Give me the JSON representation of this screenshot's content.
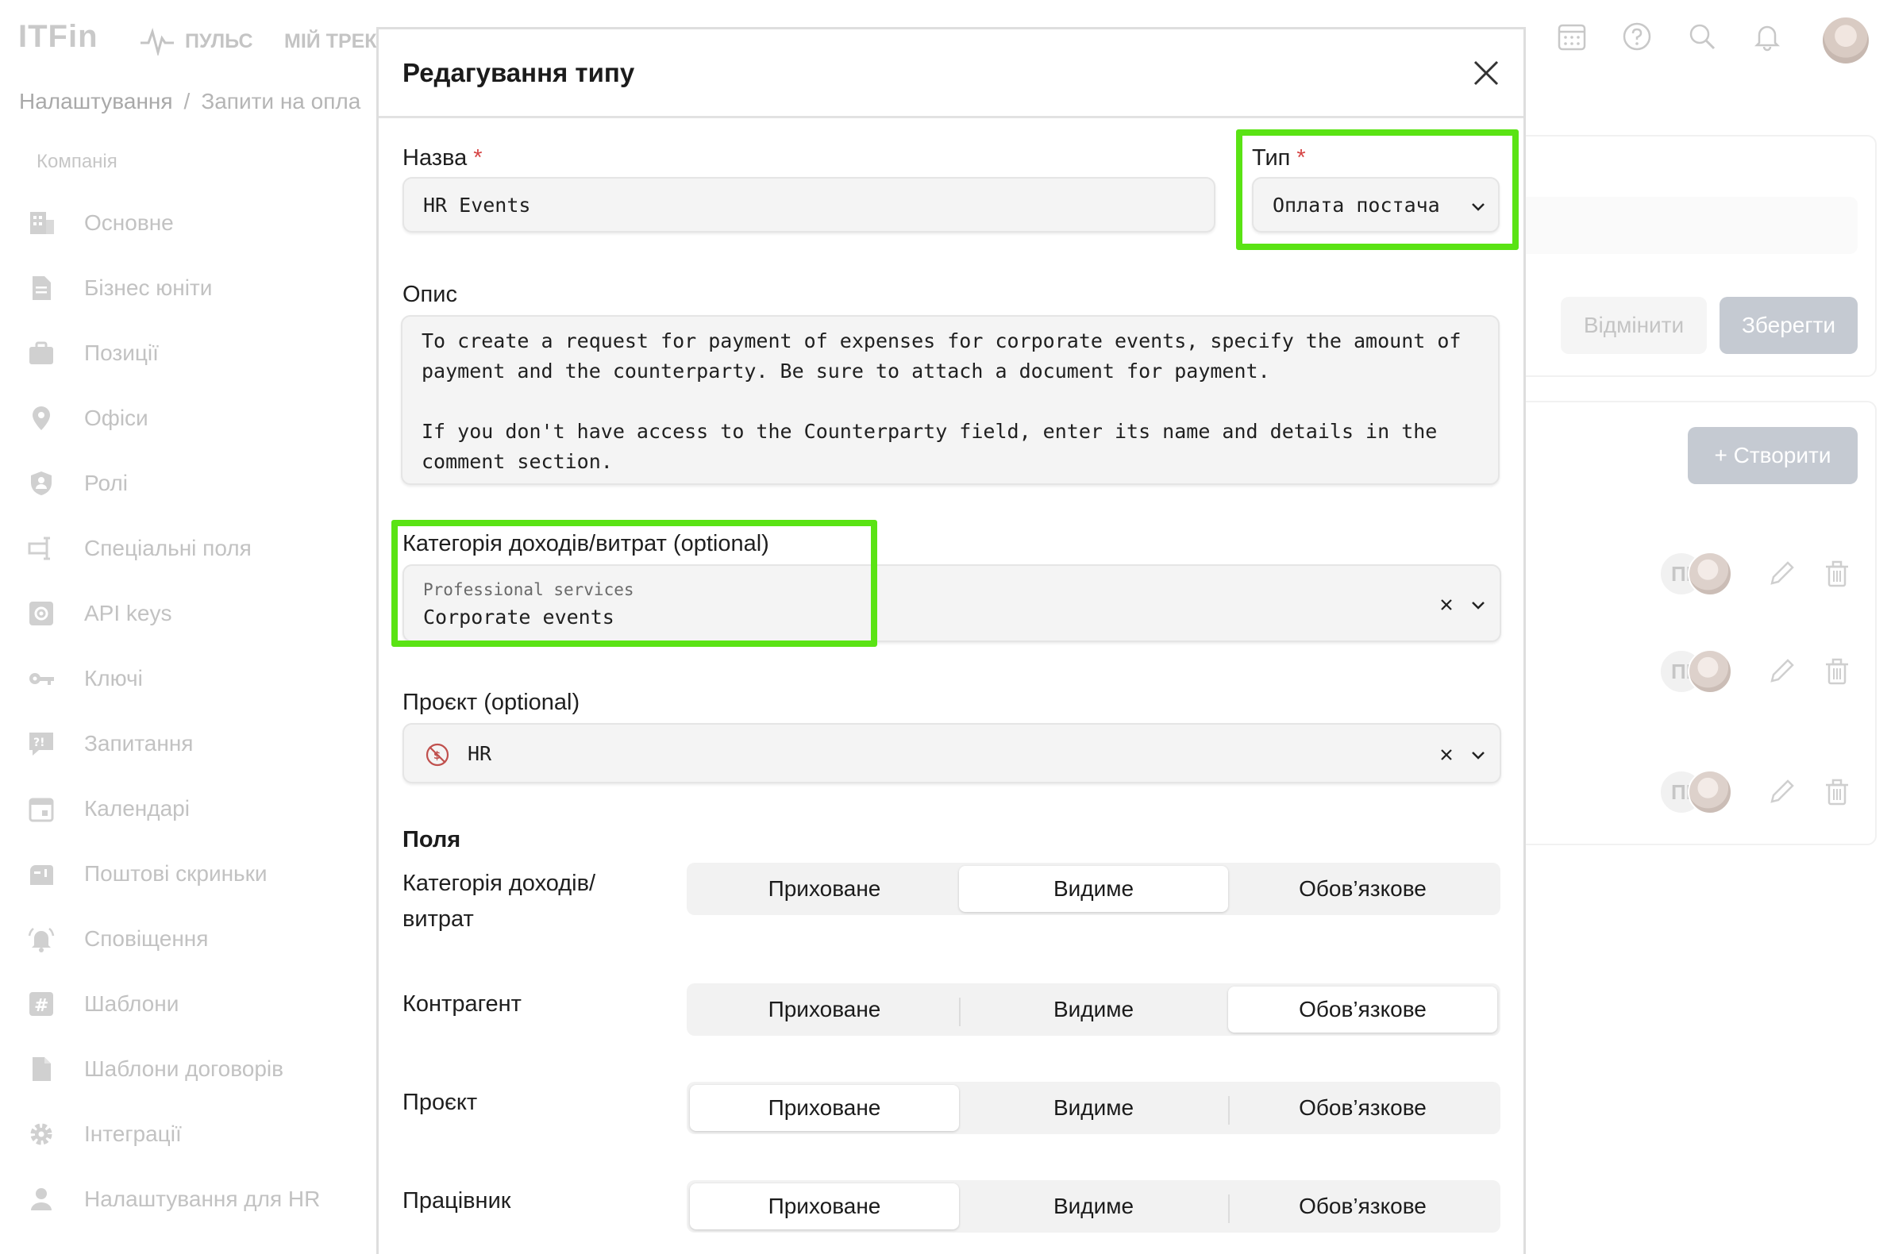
{
  "app": {
    "logo": "ITFin",
    "nav": {
      "pulse": "ПУЛЬС",
      "tracker": "МІЙ ТРЕКЕ"
    },
    "breadcrumb": {
      "first": "Налаштування",
      "separator": "/",
      "second": "Запити на опла"
    },
    "sidebar": {
      "section": "Компанія",
      "items": [
        {
          "label": "Основне",
          "icon": "building-icon"
        },
        {
          "label": "Бізнес юніти",
          "icon": "document-icon"
        },
        {
          "label": "Позиції",
          "icon": "briefcase-icon"
        },
        {
          "label": "Офіси",
          "icon": "map-pin-icon"
        },
        {
          "label": "Ролі",
          "icon": "shield-user-icon"
        },
        {
          "label": "Спеціальні поля",
          "icon": "custom-field-icon"
        },
        {
          "label": "API keys",
          "icon": "api-gear-icon"
        },
        {
          "label": "Ключі",
          "icon": "key-icon"
        },
        {
          "label": "Запитання",
          "icon": "question-chat-icon"
        },
        {
          "label": "Календарі",
          "icon": "calendar-icon"
        },
        {
          "label": "Поштові скриньки",
          "icon": "mailbox-icon"
        },
        {
          "label": "Сповіщення",
          "icon": "bell-icon"
        },
        {
          "label": "Шаблони",
          "icon": "hash-icon"
        },
        {
          "label": "Шаблони договорів",
          "icon": "file-icon"
        },
        {
          "label": "Інтеграції",
          "icon": "gear-icon"
        },
        {
          "label": "Налаштування для HR",
          "icon": "person-icon"
        }
      ]
    },
    "right": {
      "cancel": "Відмінити",
      "save": "Зберегти",
      "create": "+ Створити",
      "row_initials": "ПІ"
    }
  },
  "modal": {
    "title": "Редагування типу",
    "name": {
      "label": "Назва",
      "required": "*",
      "value": "HR Events"
    },
    "type": {
      "label": "Тип",
      "required": "*",
      "value": "Оплата постача"
    },
    "description": {
      "label": "Опис",
      "value": "To create a request for payment of expenses for corporate events, specify the amount of\npayment and the counterparty. Be sure to attach a document for payment.\n\nIf you don't have access to the Counterparty field, enter its name and details in the\ncomment section."
    },
    "category": {
      "label": "Категорія доходів/витрат (optional)",
      "parent": "Professional services",
      "value": "Corporate events",
      "clear": "×"
    },
    "project": {
      "label": "Проєкт (optional)",
      "value": "HR",
      "clear": "×"
    },
    "fields": {
      "title": "Поля",
      "options": [
        "Приховане",
        "Видиме",
        "Обов’язкове"
      ],
      "rows": [
        {
          "label": "Категорія доходів/\nвитрат",
          "selected": 1
        },
        {
          "label": "Контрагент",
          "selected": 2
        },
        {
          "label": "Проєкт",
          "selected": 0
        },
        {
          "label": "Працівник",
          "selected": 0
        }
      ]
    }
  },
  "colors": {
    "highlight": "#5ae314",
    "required": "#d64545",
    "disabled_button": "#c5cad2"
  }
}
